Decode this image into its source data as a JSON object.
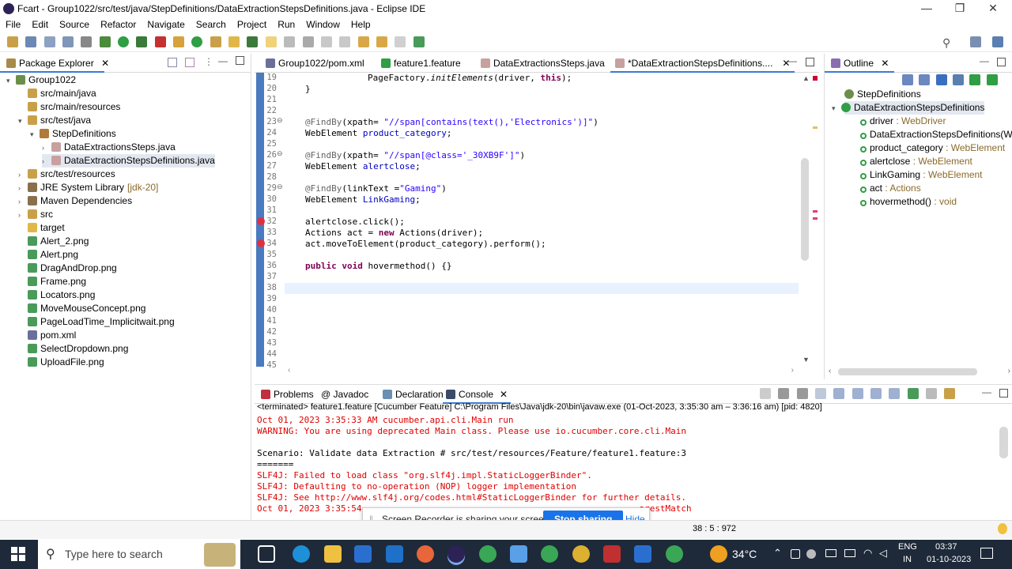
{
  "window": {
    "title": "Fcart - Group1022/src/test/java/StepDefinitions/DataExtractionStepsDefinitions.java - Eclipse IDE",
    "min_icon": "—",
    "max_icon": "❐",
    "close_icon": "✕"
  },
  "menu": [
    "File",
    "Edit",
    "Source",
    "Refactor",
    "Navigate",
    "Search",
    "Project",
    "Run",
    "Window",
    "Help"
  ],
  "package_explorer": {
    "title": "Package Explorer",
    "tree": [
      {
        "label": "Group1022",
        "level": 0,
        "twisty": "▾"
      },
      {
        "label": "src/main/java",
        "level": 1,
        "twisty": ""
      },
      {
        "label": "src/main/resources",
        "level": 1,
        "twisty": ""
      },
      {
        "label": "src/test/java",
        "level": 1,
        "twisty": "▾"
      },
      {
        "label": "StepDefinitions",
        "level": 2,
        "twisty": "▾"
      },
      {
        "label": "DataExtractionsSteps.java",
        "level": 3,
        "twisty": "›"
      },
      {
        "label": "DataExtractionStepsDefinitions.java",
        "level": 3,
        "twisty": "›",
        "selected": true
      },
      {
        "label": "src/test/resources",
        "level": 1,
        "twisty": "›"
      },
      {
        "label": "JRE System Library",
        "suffix": "[jdk-20]",
        "level": 1,
        "twisty": "›"
      },
      {
        "label": "Maven Dependencies",
        "level": 1,
        "twisty": "›"
      },
      {
        "label": "src",
        "level": 1,
        "twisty": "›"
      },
      {
        "label": "target",
        "level": 1,
        "twisty": ""
      },
      {
        "label": "Alert_2.png",
        "level": 1,
        "twisty": ""
      },
      {
        "label": "Alert.png",
        "level": 1,
        "twisty": ""
      },
      {
        "label": "DragAndDrop.png",
        "level": 1,
        "twisty": ""
      },
      {
        "label": "Frame.png",
        "level": 1,
        "twisty": ""
      },
      {
        "label": "Locators.png",
        "level": 1,
        "twisty": ""
      },
      {
        "label": "MoveMouseConcept.png",
        "level": 1,
        "twisty": ""
      },
      {
        "label": "PageLoadTime_Implicitwait.png",
        "level": 1,
        "twisty": ""
      },
      {
        "label": "pom.xml",
        "level": 1,
        "twisty": ""
      },
      {
        "label": "SelectDropdown.png",
        "level": 1,
        "twisty": ""
      },
      {
        "label": "UploadFile.png",
        "level": 1,
        "twisty": ""
      }
    ]
  },
  "editor_tabs": [
    {
      "label": "Group1022/pom.xml"
    },
    {
      "label": "feature1.feature"
    },
    {
      "label": "DataExtractionsSteps.java"
    },
    {
      "label": "*DataExtractionStepsDefinitions....",
      "active": true
    }
  ],
  "code_lines": [
    {
      "n": "19",
      "html": "        PageFactory.<i>initElements</i>(driver, <span class='kw'>this</span>);"
    },
    {
      "n": "20",
      "html": "}"
    },
    {
      "n": "21",
      "html": ""
    },
    {
      "n": "22",
      "html": ""
    },
    {
      "n": "23",
      "html": "<span class='an'>@FindBy</span>(xpath= <span class='st'>\"//span[contains(text(),'Electronics')]\"</span>)"
    },
    {
      "n": "24",
      "html": "WebElement <span class='fd'>product_category</span>;"
    },
    {
      "n": "25",
      "html": ""
    },
    {
      "n": "26",
      "html": "<span class='an'>@FindBy</span>(xpath= <span class='st'>\"//span[@class='_30XB9F']\"</span>)"
    },
    {
      "n": "27",
      "html": "WebElement <span class='fd'>alertclose</span>;"
    },
    {
      "n": "28",
      "html": ""
    },
    {
      "n": "29",
      "html": "<span class='an'>@FindBy</span>(linkText =<span class='st'>\"Gaming\"</span>)"
    },
    {
      "n": "30",
      "html": "WebElement <span class='fd'>LinkGaming</span>;"
    },
    {
      "n": "31",
      "html": ""
    },
    {
      "n": "32",
      "html": "alertclose.click();"
    },
    {
      "n": "33",
      "html": "Actions act = <span class='kw'>new</span> Actions(driver);"
    },
    {
      "n": "34",
      "html": "act.moveToElement(product_category).perform();"
    },
    {
      "n": "35",
      "html": ""
    },
    {
      "n": "36",
      "html": "<span class='kw'>public</span> <span class='kw'>void</span> hovermethod() {}"
    },
    {
      "n": "37",
      "html": ""
    },
    {
      "n": "38",
      "html": ""
    },
    {
      "n": "39",
      "html": ""
    },
    {
      "n": "40",
      "html": ""
    },
    {
      "n": "41",
      "html": ""
    },
    {
      "n": "42",
      "html": ""
    },
    {
      "n": "43",
      "html": ""
    },
    {
      "n": "44",
      "html": ""
    },
    {
      "n": "45",
      "html": ""
    }
  ],
  "outline": {
    "title": "Outline",
    "items": [
      {
        "label": "StepDefinitions",
        "type": "",
        "level": 0
      },
      {
        "label": "DataExtractionStepsDefinitions",
        "type": "",
        "level": 0,
        "selected": true
      },
      {
        "label": "driver",
        "type": " : WebDriver",
        "level": 1
      },
      {
        "label": "DataExtractionStepsDefinitions(We",
        "type": "",
        "level": 1
      },
      {
        "label": "product_category",
        "type": " : WebElement",
        "level": 1
      },
      {
        "label": "alertclose",
        "type": " : WebElement",
        "level": 1
      },
      {
        "label": "LinkGaming",
        "type": " : WebElement",
        "level": 1
      },
      {
        "label": "act",
        "type": " : Actions",
        "level": 1
      },
      {
        "label": "hovermethod()",
        "type": " : void",
        "level": 1
      }
    ]
  },
  "bottom_tabs": [
    {
      "label": "Problems"
    },
    {
      "label": "@ Javadoc"
    },
    {
      "label": "Declaration"
    },
    {
      "label": "Console",
      "active": true
    }
  ],
  "console": {
    "header": "<terminated> feature1.feature [Cucumber Feature] C:\\Program Files\\Java\\jdk-20\\bin\\javaw.exe  (01-Oct-2023, 3:35:30 am – 3:36:16 am) [pid: 4820]",
    "lines": [
      {
        "text": "Oct 01, 2023 3:35:33 AM cucumber.api.cli.Main run",
        "red": true
      },
      {
        "text": "WARNING: You are using deprecated Main class. Please use io.cucumber.core.cli.Main",
        "red": true
      },
      {
        "text": "",
        "red": false
      },
      {
        "text": "Scenario: Validate data Extraction # src/test/resources/Feature/feature1.feature:3",
        "red": false
      },
      {
        "text": "=======",
        "red": false
      },
      {
        "text": "SLF4J: Failed to load class \"org.slf4j.impl.StaticLoggerBinder\".",
        "red": true
      },
      {
        "text": "SLF4J: Defaulting to no-operation (NOP) logger implementation",
        "red": true
      },
      {
        "text": "SLF4J: See http://www.slf4j.org/codes.html#StaticLoggerBinder for further details.",
        "red": true
      },
      {
        "text": "Oct 01, 2023 3:35:54                                                     arestMatch",
        "red": true
      }
    ]
  },
  "screen_share": {
    "text": "Screen Recorder is sharing your screen.",
    "stop": "Stop sharing",
    "hide": "Hide"
  },
  "status": {
    "position": "38 : 5 : 972"
  },
  "taskbar": {
    "search_placeholder": "Type here to search",
    "weather": "34°C",
    "lang1": "ENG",
    "lang2": "IN",
    "time": "03:37",
    "date": "01-10-2023"
  },
  "colors": {
    "accent": "#3a7bd5",
    "error": "#e00000",
    "stop_button": "#1a73e8",
    "taskbar": "#1e2a3a"
  }
}
